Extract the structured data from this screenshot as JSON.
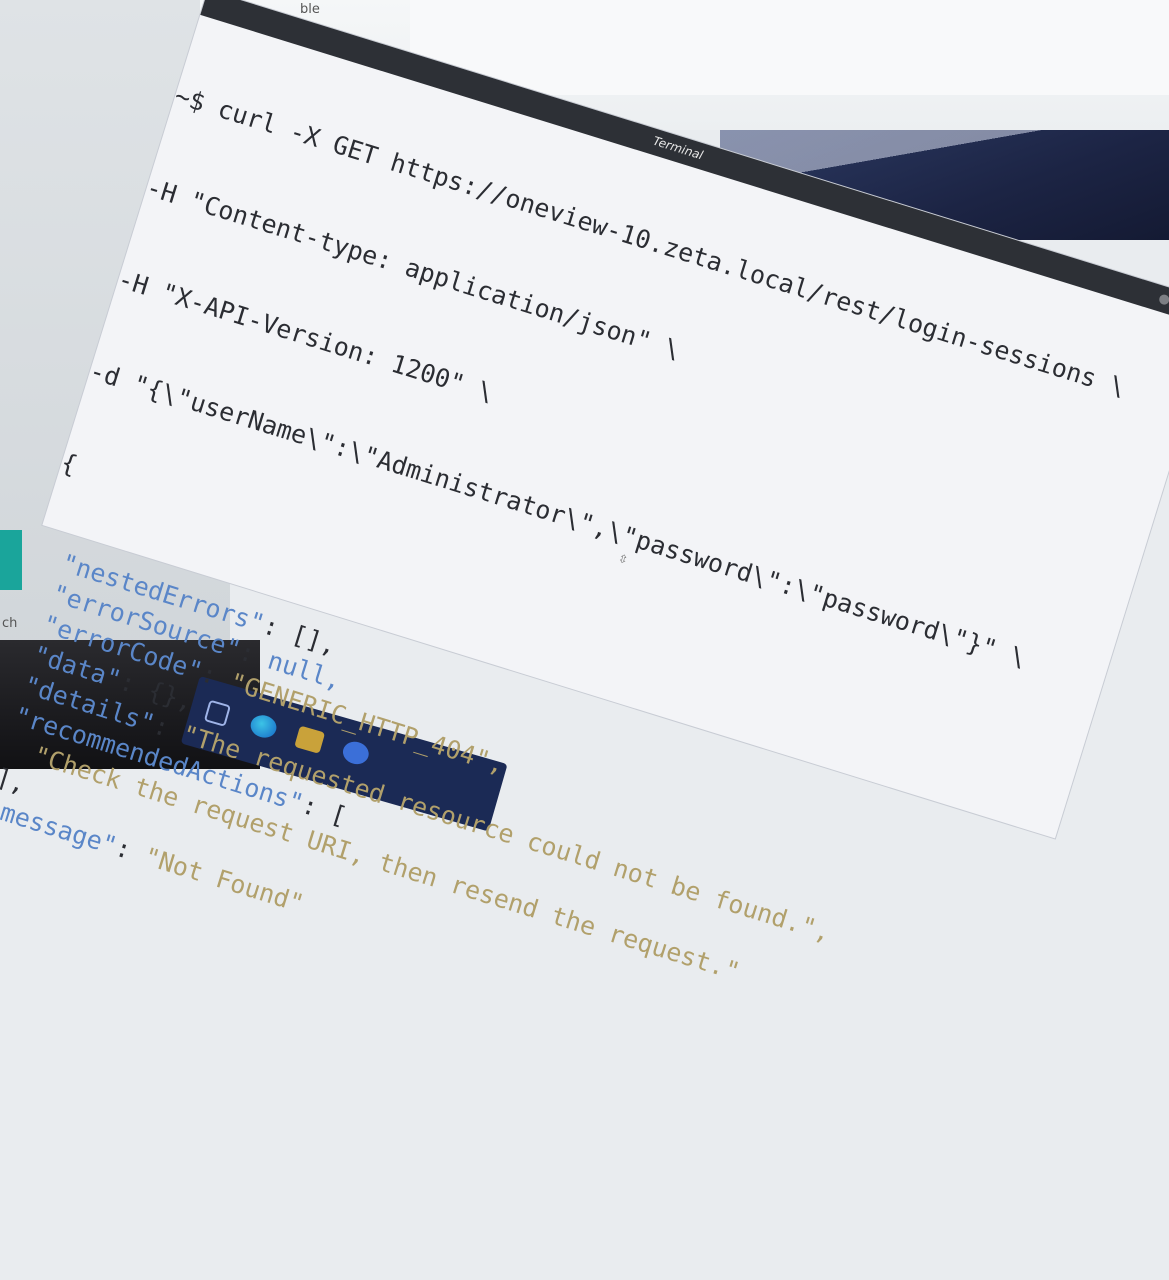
{
  "background": {
    "top_fragment": "ble",
    "side_fragment": "ch"
  },
  "terminal": {
    "title": "Terminal",
    "lines": [
      {
        "cmd": "~$ curl -X GET https://oneview-10.zeta.local/rest/login-sessions \\"
      },
      {
        "cmd": "-H \"Content-type: application/json\" \\"
      },
      {
        "cmd": "-H \"X-API-Version: 1200\" \\"
      },
      {
        "cmd": "-d \"{\\\"userName\\\":\\\"Administrator\\\",\\\"password\\\":\\\"password\\\"}\" \\"
      }
    ],
    "response": {
      "open_brace": "{",
      "rows": [
        {
          "key": "\"nestedErrors\"",
          "sep": ": ",
          "value": "[],",
          "value_kind": "plain"
        },
        {
          "key": "\"errorSource\"",
          "sep": ": ",
          "value": "null,",
          "value_kind": "keyword"
        },
        {
          "key": "\"errorCode\"",
          "sep": ": ",
          "value": "\"GENERIC_HTTP_404\",",
          "value_kind": "string"
        },
        {
          "key": "\"data\"",
          "sep": ": ",
          "value": "{},",
          "value_kind": "plain"
        },
        {
          "key": "\"details\"",
          "sep": ": ",
          "value": "\"The requested resource could not be found.\",",
          "value_kind": "string"
        },
        {
          "key": "\"recommendedActions\"",
          "sep": ": ",
          "value": "[",
          "value_kind": "plain"
        },
        {
          "key": "",
          "sep": "",
          "value": "\"Check the request URI, then resend the request.\"",
          "value_kind": "string"
        },
        {
          "key": "",
          "sep": "",
          "value": "],",
          "value_kind": "plain"
        },
        {
          "key": "\"message\"",
          "sep": ": ",
          "value": "\"Not Found\"",
          "value_kind": "string"
        }
      ],
      "close_brace": "}"
    }
  },
  "colors": {
    "terminal_bg": "#f3f4f7",
    "key_blue": "#5a86c8",
    "string_tan": "#b1a06b",
    "text": "#2b2d33",
    "titlebar": "#2d3036",
    "taskbar": "#1b2a55"
  },
  "icons": [
    "windows-start-icon",
    "edge-browser-icon",
    "file-explorer-icon",
    "mouse-cursor-icon"
  ]
}
